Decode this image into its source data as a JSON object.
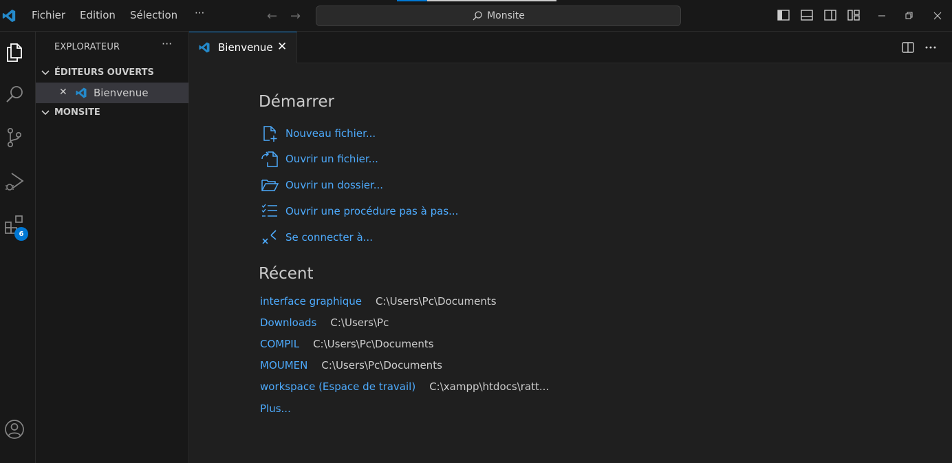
{
  "titlebar": {
    "menu": [
      "Fichier",
      "Edition",
      "Sélection",
      "···"
    ],
    "search_text": "Monsite"
  },
  "activity": {
    "extensions_badge": "6"
  },
  "sidebar": {
    "title": "EXPLORATEUR",
    "more": "···",
    "open_editors_label": "ÉDITEURS OUVERTS",
    "open_editor_item": "Bienvenue",
    "folder_label": "MONSITE"
  },
  "tabs": {
    "active_label": "Bienvenue"
  },
  "welcome": {
    "start_heading": "Démarrer",
    "start_items": [
      {
        "label": "Nouveau fichier...",
        "icon": "new-file-icon"
      },
      {
        "label": "Ouvrir un fichier...",
        "icon": "open-file-icon"
      },
      {
        "label": "Ouvrir un dossier...",
        "icon": "open-folder-icon"
      },
      {
        "label": "Ouvrir une procédure pas à pas...",
        "icon": "checklist-icon"
      },
      {
        "label": "Se connecter à...",
        "icon": "remote-icon"
      }
    ],
    "recent_heading": "Récent",
    "recent": [
      {
        "name": "interface graphique",
        "path": "C:\\Users\\Pc\\Documents"
      },
      {
        "name": "Downloads",
        "path": "C:\\Users\\Pc"
      },
      {
        "name": "COMPIL",
        "path": "C:\\Users\\Pc\\Documents"
      },
      {
        "name": "MOUMEN",
        "path": "C:\\Users\\Pc\\Documents"
      },
      {
        "name": "workspace (Espace de travail)",
        "path": "C:\\xampp\\htdocs\\ratt..."
      }
    ],
    "more_label": "Plus..."
  },
  "colors": {
    "accent": "#0078d4",
    "link": "#4daafc",
    "background": "#1f1f1f",
    "chrome": "#181818"
  }
}
